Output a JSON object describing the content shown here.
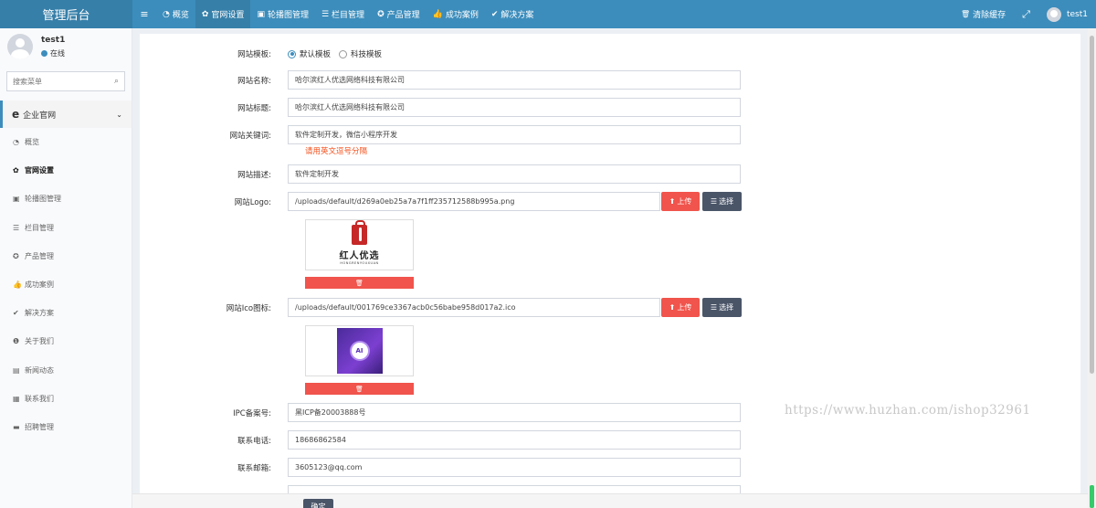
{
  "header": {
    "logo": "管理后台",
    "toggle_icon": "≡",
    "nav": [
      {
        "label": "概览",
        "icon": "◔"
      },
      {
        "label": "官网设置",
        "icon": "✿"
      },
      {
        "label": "轮播图管理",
        "icon": "▣"
      },
      {
        "label": "栏目管理",
        "icon": "☰"
      },
      {
        "label": "产品管理",
        "icon": "✪"
      },
      {
        "label": "成功案例",
        "icon": "👍"
      },
      {
        "label": "解决方案",
        "icon": "✔"
      }
    ],
    "clear_cache": "清除缓存",
    "clear_icon": "🗑",
    "fullscreen_icon": "⤢",
    "username": "test1"
  },
  "sidebar": {
    "user": {
      "name": "test1",
      "status": "在线"
    },
    "search_placeholder": "搜索菜单",
    "search_icon": "⌕",
    "group": {
      "label": "企业官网",
      "icon": "e",
      "chevron": "⌄"
    },
    "items": [
      {
        "label": "概览",
        "icon": "◔"
      },
      {
        "label": "官网设置",
        "icon": "✿"
      },
      {
        "label": "轮播图管理",
        "icon": "▣"
      },
      {
        "label": "栏目管理",
        "icon": "☰"
      },
      {
        "label": "产品管理",
        "icon": "✪"
      },
      {
        "label": "成功案例",
        "icon": "👍"
      },
      {
        "label": "解决方案",
        "icon": "✔"
      },
      {
        "label": "关于我们",
        "icon": "❶"
      },
      {
        "label": "新闻动态",
        "icon": "▤"
      },
      {
        "label": "联系我们",
        "icon": "▦"
      },
      {
        "label": "招聘管理",
        "icon": "▬"
      }
    ]
  },
  "form": {
    "template": {
      "label": "网站模板:",
      "options": [
        "默认模板",
        "科技模板"
      ],
      "selected": "默认模板"
    },
    "site_name": {
      "label": "网站名称:",
      "value": "哈尔滨红人优选网络科技有限公司"
    },
    "site_title": {
      "label": "网站标题:",
      "value": "哈尔滨红人优选网络科技有限公司"
    },
    "keywords": {
      "label": "网站关键词:",
      "value": "软件定制开发，微信小程序开发",
      "hint": "请用英文逗号分隔"
    },
    "description": {
      "label": "网站描述:",
      "value": "软件定制开发"
    },
    "logo": {
      "label": "网站Logo:",
      "value": "/uploads/default/d269a0eb25a7a7f1ff235712588b995a.png",
      "preview_text": "红人优选",
      "preview_sub": "HONGRENYOUXUAN"
    },
    "favicon": {
      "label": "网站Ico图标:",
      "value": "/uploads/default/001769ce3367acb0c56babe958d017a2.ico",
      "preview_text": "AI"
    },
    "icp": {
      "label": "IPC备案号:",
      "value": "黑ICP备20003888号"
    },
    "phone": {
      "label": "联系电话:",
      "value": "18686862584"
    },
    "email": {
      "label": "联系邮箱:",
      "value": "3605123@qq.com"
    },
    "upload_label": "上传",
    "select_label": "选择",
    "upload_icon": "⬆",
    "select_icon": "☰",
    "delete_icon": "🗑",
    "submit_label": "确定"
  },
  "watermark": "https://www.huzhan.com/ishop32961"
}
